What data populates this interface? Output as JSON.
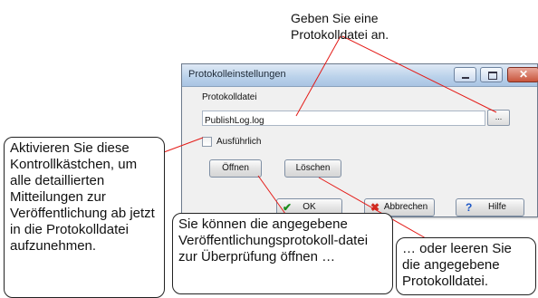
{
  "dialog": {
    "title": "Protokolleinstellungen",
    "section_label": "Protokolldatei",
    "file_value": "PublishLog.log",
    "browse_label": "...",
    "verbose_label": "Ausführlich",
    "verbose_checked": false,
    "open_label": "Öffnen",
    "clear_label": "Löschen",
    "ok_label": "OK",
    "cancel_label": "Abbrechen",
    "help_label": "Hilfe"
  },
  "callouts": {
    "top": "Geben Sie eine Protokolldatei an.",
    "left": "Aktivieren Sie diese Kontrollkästchen, um alle detaillierten Mitteilungen zur Veröffentlichung ab jetzt in die Protokolldatei aufzunehmen.",
    "middle": "Sie können die angegebene Veröffentlichungsprotokoll-datei zur Überprüfung öffnen …",
    "right": "… oder leeren Sie die angegebene Protokolldatei."
  },
  "colors": {
    "leader_line": "#e41b17",
    "callout_border": "#222222"
  }
}
